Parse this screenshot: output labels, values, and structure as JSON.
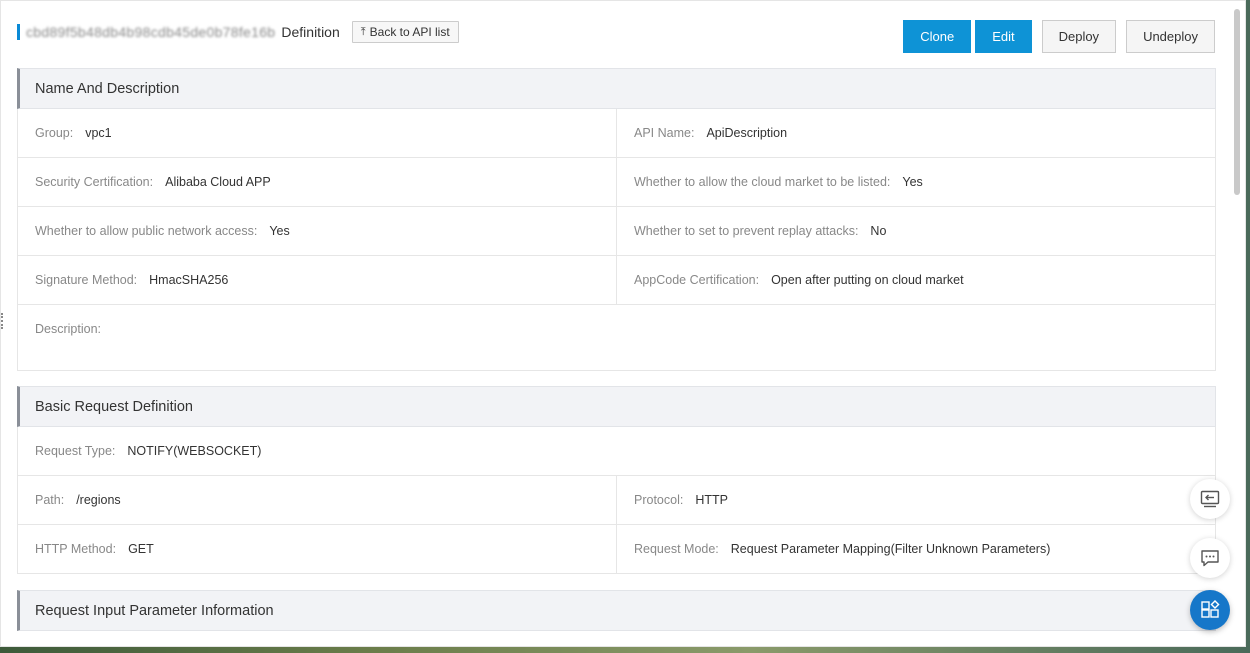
{
  "header": {
    "api_id": "cbd89f5b48db4b98cdb45de0b78fe16b",
    "title_suffix": "Definition",
    "back_label": "Back to API list",
    "actions": {
      "clone": "Clone",
      "edit": "Edit",
      "deploy": "Deploy",
      "undeploy": "Undeploy"
    }
  },
  "name_desc": {
    "title": "Name And Description",
    "group_label": "Group:",
    "group_value": "vpc1",
    "api_name_label": "API Name:",
    "api_name_value": "ApiDescription",
    "security_label": "Security Certification:",
    "security_value": "Alibaba Cloud APP",
    "market_label": "Whether to allow the cloud market to be listed:",
    "market_value": "Yes",
    "public_label": "Whether to allow public network access:",
    "public_value": "Yes",
    "replay_label": "Whether to set to prevent replay attacks:",
    "replay_value": "No",
    "signature_label": "Signature Method:",
    "signature_value": "HmacSHA256",
    "appcode_label": "AppCode Certification:",
    "appcode_value": "Open after putting on cloud market",
    "description_label": "Description:",
    "description_value": ""
  },
  "basic_request": {
    "title": "Basic Request Definition",
    "type_label": "Request Type:",
    "type_value": "NOTIFY(WEBSOCKET)",
    "path_label": "Path:",
    "path_value": "/regions",
    "protocol_label": "Protocol:",
    "protocol_value": "HTTP",
    "method_label": "HTTP Method:",
    "method_value": "GET",
    "mode_label": "Request Mode:",
    "mode_value": "Request Parameter Mapping(Filter Unknown Parameters)"
  },
  "input_params": {
    "title": "Request Input Parameter Information"
  },
  "colors": {
    "primary": "#0e93d6",
    "section_bg": "#f2f3f6",
    "fab_blue": "#1677c9"
  },
  "icons": [
    "back-arrow-icon",
    "collapse-panel-icon",
    "chat-icon",
    "apps-icon"
  ]
}
